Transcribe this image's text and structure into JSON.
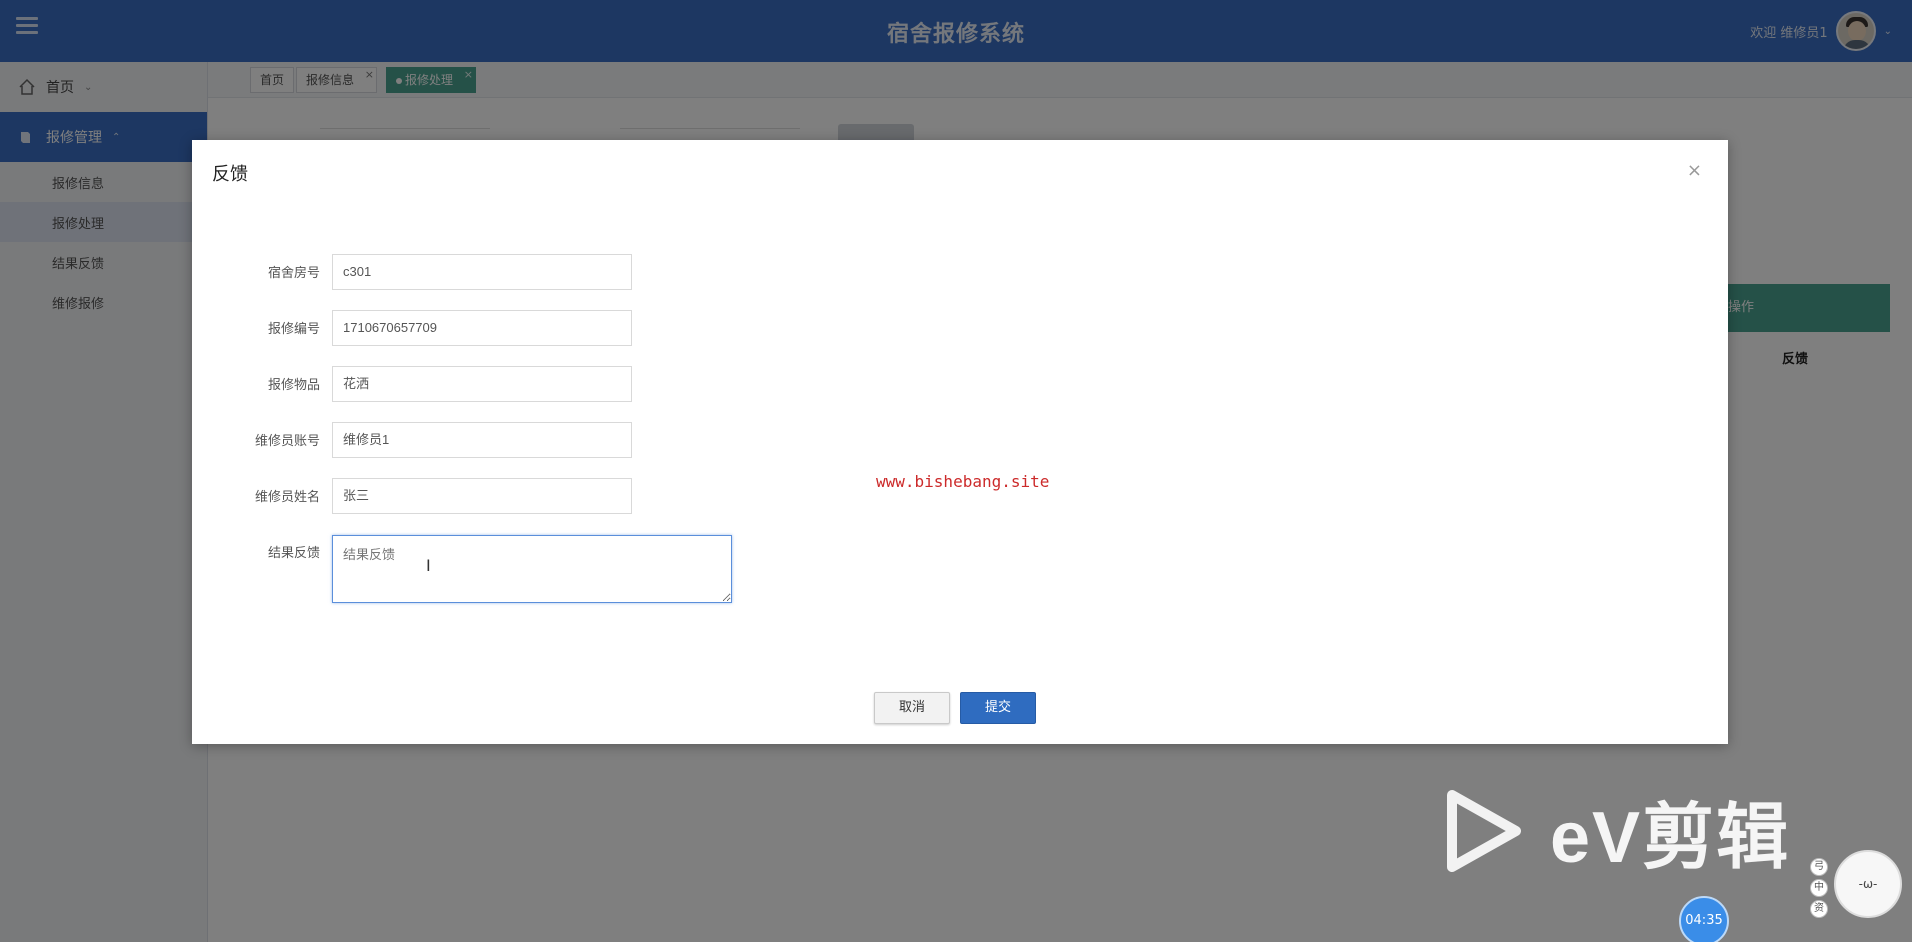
{
  "header": {
    "title": "宿舍报修系统",
    "welcome": "欢迎 维修员1"
  },
  "sidebar": {
    "items": [
      {
        "label": "首页"
      },
      {
        "label": "报修管理",
        "children": [
          "报修信息",
          "报修处理",
          "结果反馈",
          "维修报修"
        ]
      }
    ]
  },
  "tabs": [
    {
      "label": "首页"
    },
    {
      "label": "报修信息"
    },
    {
      "label": "报修处理"
    }
  ],
  "background": {
    "table_header": "操作",
    "table_action": "反馈"
  },
  "modal": {
    "title": "反馈",
    "fields": [
      {
        "label": "宿舍房号",
        "value": "c301"
      },
      {
        "label": "报修编号",
        "value": "1710670657709"
      },
      {
        "label": "报修物品",
        "value": "花洒"
      },
      {
        "label": "维修员账号",
        "value": "维修员1"
      },
      {
        "label": "维修员姓名",
        "value": "张三"
      }
    ],
    "feedback_label": "结果反馈",
    "feedback_placeholder": "结果反馈",
    "cancel": "取消",
    "submit": "提交",
    "watermark_url": "www.bishebang.site"
  },
  "overlay_watermark": {
    "brand": "eV剪辑",
    "timer": "04:35",
    "side_badges": [
      "弓",
      "中",
      "资"
    ]
  },
  "colors": {
    "header": "#3a6fc4",
    "active_tab": "#4aa391",
    "submit": "#2f6cc0"
  }
}
